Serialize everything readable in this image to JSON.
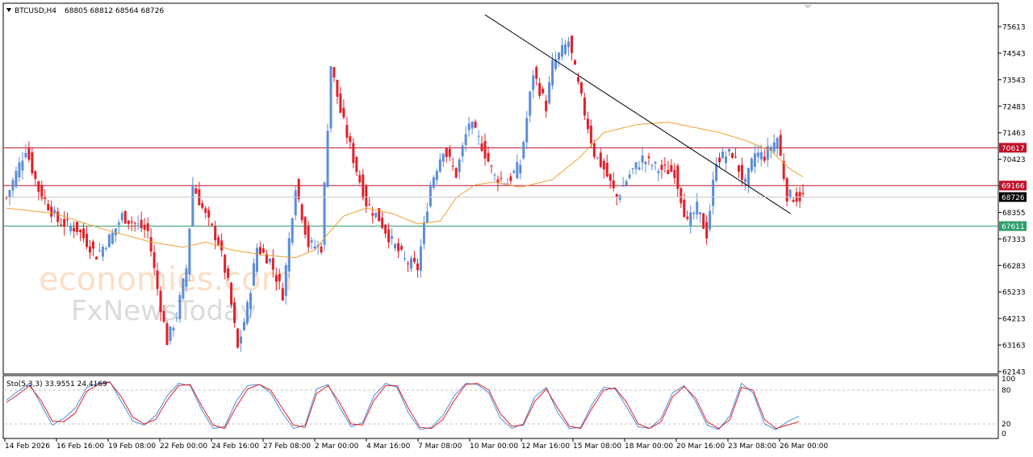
{
  "header": {
    "symbol": "BTCUSD,H4",
    "ohlc": "68805 68812 68564 68726"
  },
  "watermark": {
    "line1": "economies.com",
    "line2": "FxNewsToday"
  },
  "colors": {
    "bull": "#5b8dd9",
    "bear": "#e0202a",
    "ma": "#f0a030",
    "resistance": "#c0102a",
    "support": "#2e9e6a",
    "trendline": "#000000",
    "stoch_main": "#4a8fd9",
    "stoch_signal": "#e0202a"
  },
  "chart_data": [
    {
      "type": "candlestick",
      "symbol": "BTCUSD",
      "timeframe": "H4",
      "ylim": [
        62000,
        76100
      ],
      "y_ticks": [
        "75613",
        "74543",
        "73543",
        "72483",
        "71463",
        "70423",
        "69403",
        "68355",
        "67333",
        "66283",
        "65233",
        "64213",
        "63163",
        "62143"
      ],
      "x_ticks": [
        "14 Feb 2026",
        "16 Feb 16:00",
        "19 Feb 08:00",
        "22 Feb 00:00",
        "24 Feb 16:00",
        "27 Feb 08:00",
        "2 Mar 00:00",
        "4 Mar 16:00",
        "7 Mar 08:00",
        "10 Mar 00:00",
        "12 Mar 16:00",
        "15 Mar 08:00",
        "18 Mar 00:00",
        "20 Mar 16:00",
        "23 Mar 08:00",
        "26 Mar 00:00"
      ],
      "last_price": "68726",
      "levels": [
        {
          "label": "70617",
          "value": 70617,
          "kind": "resistance"
        },
        {
          "label": "69166",
          "value": 69166,
          "kind": "resistance"
        },
        {
          "label": "67611",
          "value": 67611,
          "kind": "support"
        }
      ],
      "trendline": {
        "from": {
          "x_index": 149,
          "price": 75720
        },
        "to": {
          "x_index": 222,
          "price": 68400
        }
      },
      "close_path": [
        [
          0,
          68700
        ],
        [
          6,
          70600
        ],
        [
          10,
          69000
        ],
        [
          16,
          67800
        ],
        [
          22,
          67500
        ],
        [
          28,
          66500
        ],
        [
          33,
          67300
        ],
        [
          36,
          68000
        ],
        [
          40,
          67700
        ],
        [
          44,
          67400
        ],
        [
          47,
          65200
        ],
        [
          50,
          63200
        ],
        [
          53,
          64200
        ],
        [
          56,
          66000
        ],
        [
          58,
          69200
        ],
        [
          62,
          68000
        ],
        [
          66,
          67000
        ],
        [
          69,
          65400
        ],
        [
          72,
          62900
        ],
        [
          75,
          64500
        ],
        [
          78,
          66800
        ],
        [
          82,
          66300
        ],
        [
          86,
          65000
        ],
        [
          90,
          69200
        ],
        [
          94,
          66900
        ],
        [
          98,
          66800
        ],
        [
          101,
          73800
        ],
        [
          104,
          72000
        ],
        [
          108,
          70200
        ],
        [
          112,
          68500
        ],
        [
          116,
          67900
        ],
        [
          120,
          67000
        ],
        [
          124,
          66300
        ],
        [
          128,
          66000
        ],
        [
          132,
          69200
        ],
        [
          136,
          70600
        ],
        [
          140,
          69600
        ],
        [
          144,
          71600
        ],
        [
          148,
          70700
        ],
        [
          152,
          69500
        ],
        [
          156,
          69300
        ],
        [
          160,
          70000
        ],
        [
          164,
          73500
        ],
        [
          168,
          72200
        ],
        [
          170,
          73800
        ],
        [
          175,
          74700
        ],
        [
          178,
          73000
        ],
        [
          183,
          70400
        ],
        [
          186,
          69800
        ],
        [
          190,
          68700
        ],
        [
          194,
          69600
        ],
        [
          198,
          70200
        ],
        [
          203,
          69800
        ],
        [
          208,
          69700
        ],
        [
          212,
          67700
        ],
        [
          215,
          68300
        ],
        [
          218,
          67300
        ],
        [
          221,
          70200
        ],
        [
          226,
          70400
        ],
        [
          230,
          69200
        ],
        [
          233,
          70400
        ],
        [
          236,
          70300
        ],
        [
          240,
          71000
        ],
        [
          243,
          68800
        ],
        [
          246,
          68700
        ],
        [
          248,
          68730
        ]
      ],
      "ma_path": [
        [
          0,
          68300
        ],
        [
          15,
          68100
        ],
        [
          30,
          67500
        ],
        [
          45,
          67000
        ],
        [
          55,
          66800
        ],
        [
          62,
          67000
        ],
        [
          70,
          66700
        ],
        [
          80,
          66500
        ],
        [
          90,
          66400
        ],
        [
          96,
          66700
        ],
        [
          100,
          67300
        ],
        [
          105,
          68000
        ],
        [
          112,
          68300
        ],
        [
          120,
          68100
        ],
        [
          128,
          67700
        ],
        [
          135,
          67800
        ],
        [
          140,
          68700
        ],
        [
          146,
          69200
        ],
        [
          152,
          69300
        ],
        [
          160,
          69100
        ],
        [
          170,
          69400
        ],
        [
          178,
          70200
        ],
        [
          186,
          71200
        ],
        [
          196,
          71500
        ],
        [
          206,
          71600
        ],
        [
          214,
          71400
        ],
        [
          222,
          71200
        ],
        [
          230,
          70900
        ],
        [
          238,
          70500
        ],
        [
          244,
          69800
        ],
        [
          248,
          69500
        ]
      ]
    },
    {
      "type": "line",
      "title": "Sto(5,3,3) 33.9551 24.4169",
      "ylim": [
        0,
        100
      ],
      "y_ticks": [
        "100",
        "80",
        "20",
        "0"
      ],
      "levels": [
        80,
        20
      ],
      "series": [
        {
          "name": "main",
          "values": [
            62,
            78,
            92,
            55,
            18,
            30,
            48,
            85,
            92,
            95,
            60,
            25,
            18,
            35,
            70,
            92,
            88,
            45,
            12,
            15,
            60,
            88,
            90,
            75,
            40,
            12,
            18,
            82,
            90,
            50,
            15,
            22,
            70,
            92,
            85,
            40,
            10,
            14,
            35,
            70,
            92,
            90,
            75,
            30,
            12,
            20,
            68,
            85,
            40,
            12,
            14,
            55,
            85,
            82,
            50,
            15,
            12,
            30,
            75,
            88,
            60,
            18,
            10,
            35,
            92,
            75,
            20,
            10,
            24,
            34
          ]
        },
        {
          "name": "signal",
          "values": [
            58,
            72,
            88,
            62,
            25,
            24,
            40,
            78,
            90,
            94,
            68,
            32,
            20,
            28,
            62,
            88,
            90,
            52,
            18,
            12,
            50,
            82,
            90,
            80,
            48,
            18,
            14,
            74,
            88,
            58,
            20,
            18,
            62,
            88,
            88,
            48,
            14,
            12,
            28,
            62,
            90,
            92,
            80,
            38,
            16,
            18,
            60,
            82,
            48,
            16,
            12,
            48,
            80,
            84,
            58,
            20,
            12,
            24,
            68,
            86,
            66,
            24,
            12,
            28,
            85,
            80,
            28,
            12,
            18,
            24
          ]
        }
      ]
    }
  ]
}
